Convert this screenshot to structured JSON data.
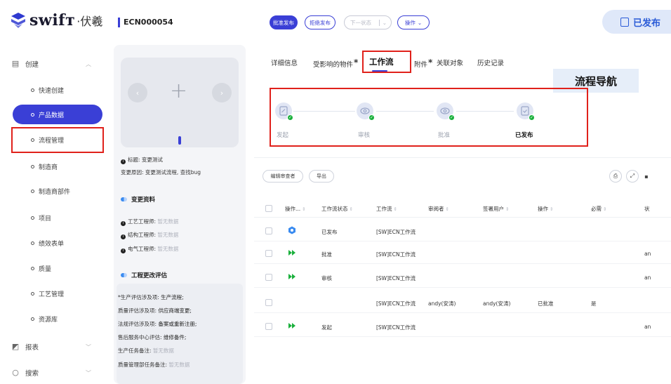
{
  "app": {
    "logo_text": "swifт",
    "logo_sub": "·伏羲"
  },
  "sidebar": {
    "groups": [
      {
        "label": "创建",
        "icon": "briefcase-icon"
      },
      {
        "label": "报表",
        "icon": "chart-icon"
      },
      {
        "label": "搜索",
        "icon": "search-icon"
      }
    ],
    "items": [
      {
        "label": "快速创建"
      },
      {
        "label": "产品数据"
      },
      {
        "label": "流程管理"
      },
      {
        "label": "制造商"
      },
      {
        "label": "制造商部件"
      },
      {
        "label": "项目"
      },
      {
        "label": "绩效表单"
      },
      {
        "label": "质量"
      },
      {
        "label": "工艺管理"
      },
      {
        "label": "资源库"
      }
    ]
  },
  "header": {
    "doc_id": "ECN000054",
    "buttons": [
      {
        "label": "批准发布",
        "style": "primary"
      },
      {
        "label": "拒绝发布",
        "style": "outline"
      },
      {
        "label": "下一状态",
        "style": "disabled"
      },
      {
        "label": "操作",
        "style": "outline"
      }
    ],
    "status": "已发布"
  },
  "left_panel": {
    "title_label": "标题:",
    "title_value": "变更测试",
    "reason_label": "变更原因:",
    "reason_value": "变更测试流程, 查找bug",
    "section_change": "变更资料",
    "engineers": [
      {
        "label": "工艺工程师:",
        "value": "暂无数据"
      },
      {
        "label": "结构工程师:",
        "value": "暂无数据"
      },
      {
        "label": "电气工程师:",
        "value": "暂无数据"
      }
    ],
    "section_eval": "工程更改评估",
    "eval_lines": [
      {
        "label": "*生产评估涉及项:",
        "value": "生产流程;",
        "muted": false
      },
      {
        "label": "质量评估涉及项:",
        "value": "供应商端变更;",
        "muted": false
      },
      {
        "label": "法规评估涉及项:",
        "value": "备案或重新注册;",
        "muted": false
      },
      {
        "label": "售后服务中心评估:",
        "value": "维修备件;",
        "muted": false
      },
      {
        "label": "生产任务备注:",
        "value": "暂无数据",
        "muted": true
      },
      {
        "label": "质量管理部任务备注:",
        "value": "暂无数据",
        "muted": true
      }
    ]
  },
  "tabs": [
    {
      "label": "详细信息",
      "star": false
    },
    {
      "label": "受影响的物件",
      "star": true
    },
    {
      "label": "工作流",
      "star": false
    },
    {
      "label": "附件",
      "star": true
    },
    {
      "label": "关联对象",
      "star": false
    },
    {
      "label": "历史记录",
      "star": false
    }
  ],
  "annotation": {
    "flow_nav": "流程导航"
  },
  "workflow": {
    "steps": [
      {
        "label": "发起",
        "icon": "edit-icon",
        "current": false
      },
      {
        "label": "审核",
        "icon": "eye-icon",
        "current": false
      },
      {
        "label": "批准",
        "icon": "eye-icon",
        "current": false
      },
      {
        "label": "已发布",
        "icon": "document-check-icon",
        "current": true
      }
    ]
  },
  "toolbar": {
    "edit_reviewers": "编辑审查者",
    "export": "导出"
  },
  "table": {
    "columns": [
      "操作...",
      "工作流状态",
      "工作流",
      "审阅者",
      "签署用户",
      "操作",
      "必需",
      "状"
    ],
    "rows": [
      {
        "icon": "target-icon",
        "status": "已发布",
        "flow": "[SW]ECN工作流",
        "reviewer": "",
        "signer": "",
        "op": "",
        "required": "",
        "extra": ""
      },
      {
        "icon": "arrow-icon",
        "status": "批准",
        "flow": "[SW]ECN工作流",
        "reviewer": "",
        "signer": "",
        "op": "",
        "required": "",
        "extra": "an"
      },
      {
        "icon": "arrow-icon",
        "status": "审核",
        "flow": "[SW]ECN工作流",
        "reviewer": "",
        "signer": "",
        "op": "",
        "required": "",
        "extra": "an"
      },
      {
        "icon": "",
        "status": "",
        "flow": "[SW]ECN工作流",
        "reviewer": "andy(安涛)",
        "signer": "andy(安涛)",
        "op": "已批准",
        "required": "是",
        "extra": ""
      },
      {
        "icon": "arrow-icon",
        "status": "发起",
        "flow": "[SW]ECN工作流",
        "reviewer": "",
        "signer": "",
        "op": "",
        "required": "",
        "extra": "an"
      }
    ]
  },
  "colors": {
    "accent": "#3a3fd6",
    "highlight_red": "#e0211b",
    "success": "#1ab03c",
    "status_blue": "#2a5bd7"
  }
}
